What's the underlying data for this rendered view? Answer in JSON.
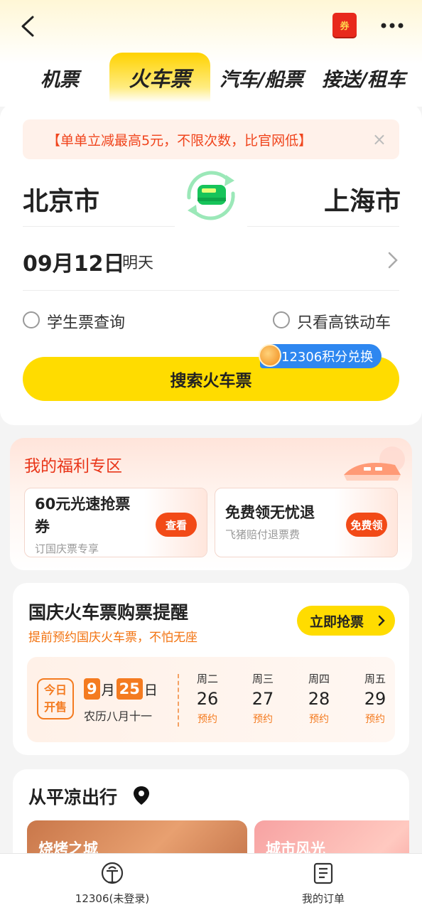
{
  "header": {
    "coupon_label": "券"
  },
  "tabs": [
    {
      "label": "机票",
      "active": false
    },
    {
      "label": "火车票",
      "active": true
    },
    {
      "label": "汽车/船票",
      "active": false
    },
    {
      "label": "接送/租车",
      "active": false
    }
  ],
  "search": {
    "promo_text": "【单单立减最高5元，不限次数，比官网低】",
    "from_city": "北京市",
    "to_city": "上海市",
    "date": "09月12日",
    "date_sub": "明天",
    "option_student": "学生票查询",
    "option_highspeed": "只看高铁动车",
    "points_badge": "12306积分兑换",
    "search_button": "搜索火车票"
  },
  "welfare": {
    "title": "我的福利专区",
    "items": [
      {
        "title": "60元光速抢票券",
        "sub": "订国庆票专享",
        "action": "查看"
      },
      {
        "title": "免费领无忧退",
        "sub": "飞猪赔付退票费",
        "action": "免费领"
      }
    ]
  },
  "holiday": {
    "title": "国庆火车票购票提醒",
    "subtitle": "提前预约国庆火车票，不怕无座",
    "grab_button": "立即抢票",
    "today_label_1": "今日",
    "today_label_2": "开售",
    "sale_month": "9",
    "sale_month_unit": "月",
    "sale_day": "25",
    "sale_day_unit": "日",
    "lunar": "农历八月十一",
    "days": [
      {
        "weekday": "周二",
        "day": "26",
        "action": "预约"
      },
      {
        "weekday": "周三",
        "day": "27",
        "action": "预约"
      },
      {
        "weekday": "周四",
        "day": "28",
        "action": "预约"
      },
      {
        "weekday": "周五",
        "day": "29",
        "action": "预约"
      }
    ]
  },
  "departure": {
    "title": "从平凉出行",
    "cards": [
      {
        "label": "烧烤之城"
      },
      {
        "label": "城市风光"
      }
    ]
  },
  "bottom_nav": [
    {
      "label": "12306(未登录)",
      "icon": "railway-logo-icon"
    },
    {
      "label": "我的订单",
      "icon": "order-list-icon"
    }
  ],
  "colors": {
    "accent_yellow": "#ffdc00",
    "promo_red": "#f0441c",
    "orange": "#f47b20",
    "badge_blue": "#2e87f0"
  }
}
